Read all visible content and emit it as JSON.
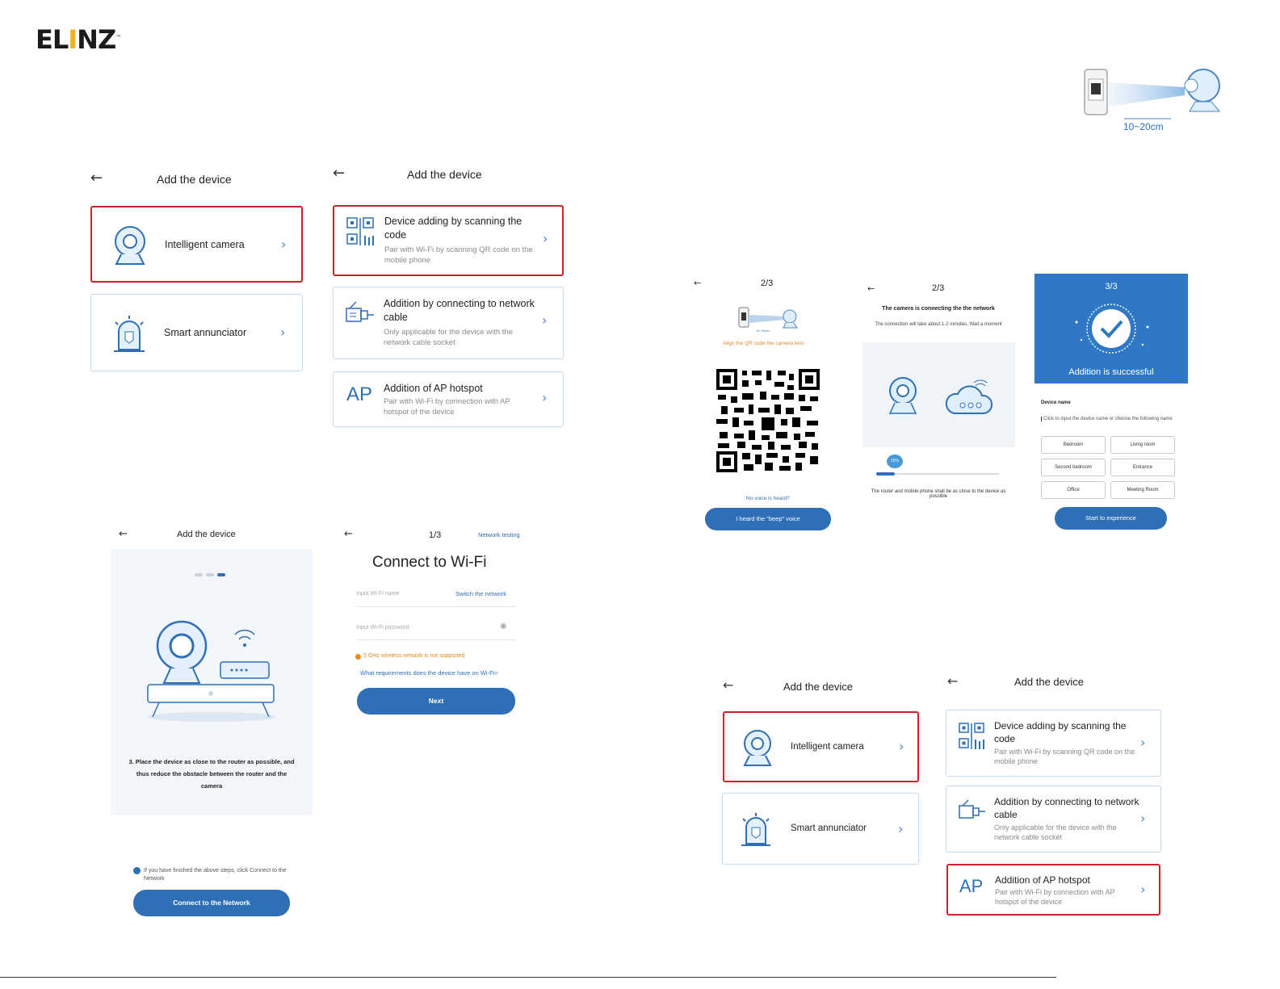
{
  "brand": {
    "logo": "ELINZ"
  },
  "hero": {
    "distance": "10~20cm"
  },
  "screen_a": {
    "back": "←",
    "title": "Add the device",
    "items": [
      {
        "label": "Intelligent camera"
      },
      {
        "label": "Smart annunciator"
      }
    ]
  },
  "screen_b": {
    "back": "←",
    "title": "Add the device",
    "options": [
      {
        "title": "Device adding by scanning the code",
        "desc": "Pair with Wi-Fi by scanning QR code on the mobile phone"
      },
      {
        "title": "Addition by connecting to network cable",
        "desc": "Only applicable for the device with the network cable socket"
      },
      {
        "ap": "AP",
        "title": "Addition of AP hotspot",
        "desc": "Pair with Wi-Fi by connection with AP hotspot of the device"
      }
    ]
  },
  "screen_c": {
    "back": "←",
    "title": "Add the device",
    "instruction": "3. Place the device as close to the router as possible, and thus reduce the obstacle between the router and the camera",
    "checkbox_label": "If you have finished the above steps, click Connect to the Network",
    "button": "Connect to the Network"
  },
  "screen_d": {
    "back": "←",
    "step": "1/3",
    "network_testing": "Network testing",
    "title": "Connect to Wi-Fi",
    "wifi_name_placeholder": "Input Wi-Fi name",
    "switch_network": "Switch the network",
    "wifi_password_placeholder": "Input Wi-Fi password",
    "warning": "5 GHz wireless network is not supported",
    "requirements_link": "What requirements does the device have on Wi-Fi>",
    "button": "Next"
  },
  "screen_e": {
    "back": "←",
    "step": "2/3",
    "distance": "10~20cm",
    "hint": "Align the QR code the camera lens",
    "no_voice": "No voice is heard?",
    "button": "I heard the \"beep\" voice"
  },
  "screen_f": {
    "back": "←",
    "step": "2/3",
    "heading": "The camera is connecting the the network",
    "sub": "The connection will take about 1-2 minutes. Wait a moment",
    "progress_label": "15%",
    "progress": 0.15,
    "note": "The router and mobile phone shall be as close to the device as possible"
  },
  "screen_g": {
    "step": "3/3",
    "success": "Addition is successful",
    "device_name_label": "Device name",
    "device_name_placeholder": "Click to input the device name or choose the following name",
    "names": [
      "Bedroom",
      "Living room",
      "Second bedroom",
      "Entrance",
      "Office",
      "Meeting Room"
    ],
    "button": "Start to experience"
  },
  "screen_h": {
    "back": "←",
    "title": "Add the device",
    "items": [
      {
        "label": "Intelligent camera"
      },
      {
        "label": "Smart annunciator"
      }
    ]
  },
  "screen_i": {
    "back": "←",
    "title": "Add the device",
    "options": [
      {
        "title": "Device adding by scanning the code",
        "desc": "Pair with Wi-Fi by scanning QR code on the mobile phone"
      },
      {
        "title": "Addition by connecting to network cable",
        "desc": "Only applicable for the device with the network cable socket"
      },
      {
        "ap": "AP",
        "title": "Addition of AP hotspot",
        "desc": "Pair with Wi-Fi by connection with AP hotspot of the device"
      }
    ]
  },
  "colors": {
    "primary": "#2e6fb6",
    "highlight": "#d0202a",
    "success_bg": "#2e78c5",
    "warning": "#e8891c"
  }
}
